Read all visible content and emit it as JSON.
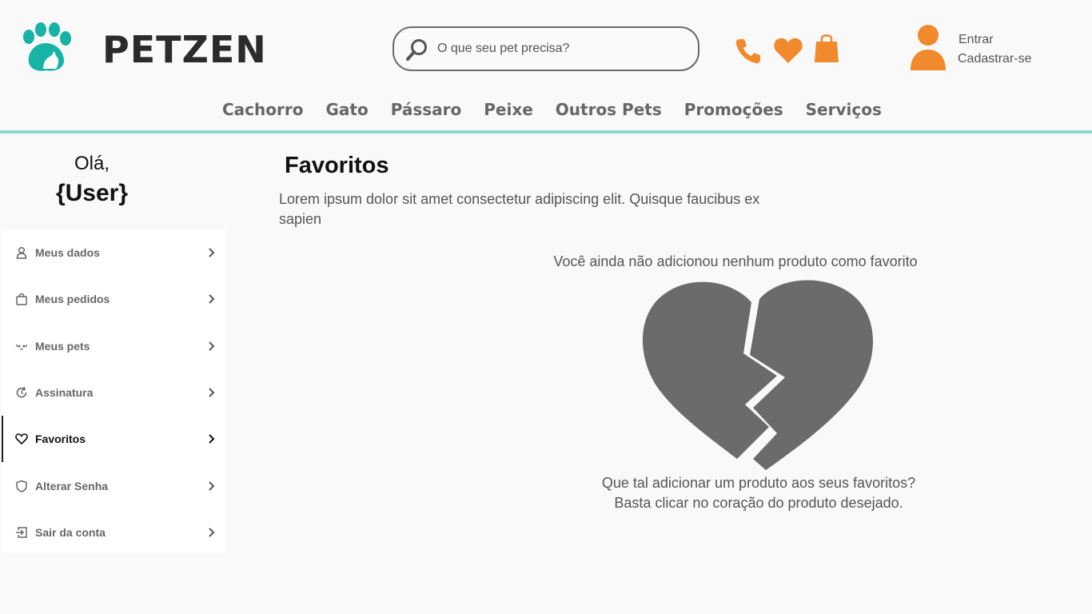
{
  "brand": {
    "name": "PETZEN",
    "accent": "#16b3a6",
    "orange": "#f08a2c",
    "divider": "#8fd8d0"
  },
  "search": {
    "placeholder": "O que seu pet precisa?",
    "value": ""
  },
  "account": {
    "login": "Entrar",
    "signup": "Cadastrar-se"
  },
  "nav": {
    "items": [
      {
        "label": "Cachorro"
      },
      {
        "label": "Gato"
      },
      {
        "label": "Pássaro"
      },
      {
        "label": "Peixe"
      },
      {
        "label": "Outros Pets"
      },
      {
        "label": "Promoções"
      },
      {
        "label": "Serviços"
      }
    ]
  },
  "sidebar": {
    "greeting": "Olá,",
    "username": "{User}",
    "items": [
      {
        "label": "Meus dados",
        "icon": "user-icon"
      },
      {
        "label": "Meus pedidos",
        "icon": "bag-icon"
      },
      {
        "label": "Meus pets",
        "icon": "pet-face-icon"
      },
      {
        "label": "Assinatura",
        "icon": "refresh-icon"
      },
      {
        "label": "Favoritos",
        "icon": "heart-icon",
        "active": true
      },
      {
        "label": "Alterar Senha",
        "icon": "shield-icon"
      },
      {
        "label": "Sair da conta",
        "icon": "logout-icon"
      }
    ]
  },
  "main": {
    "title": "Favoritos",
    "description": "Lorem ipsum dolor sit amet consectetur adipiscing elit. Quisque faucibus ex sapien",
    "empty_message": "Você ainda não adicionou nenhum produto como favorito",
    "suggestion_line1": "Que tal adicionar um produto aos seus favoritos?",
    "suggestion_line2": "Basta clicar no coração do produto desejado."
  }
}
